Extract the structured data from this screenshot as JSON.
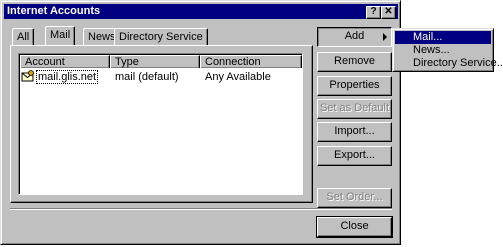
{
  "window": {
    "title": "Internet Accounts",
    "help_glyph": "?",
    "close_glyph": "✕"
  },
  "tabs": [
    {
      "label": "All"
    },
    {
      "label": "Mail"
    },
    {
      "label": "News"
    },
    {
      "label": "Directory Service"
    }
  ],
  "active_tab": "Mail",
  "list": {
    "columns": [
      "Account",
      "Type",
      "Connection"
    ],
    "rows": [
      {
        "account": "mail.glis.net",
        "type": "mail (default)",
        "connection": "Any Available",
        "icon": "mail-account-icon"
      }
    ]
  },
  "buttons": {
    "add": "Add",
    "remove": "Remove",
    "properties": "Properties",
    "set_default": "Set as Default",
    "import": "Import...",
    "export": "Export...",
    "set_order": "Set Order...",
    "close": "Close"
  },
  "add_menu": {
    "items": [
      "Mail...",
      "News...",
      "Directory Service..."
    ],
    "selected": "Mail..."
  },
  "colors": {
    "titlebar": "#000080",
    "face": "#c0c0c0",
    "highlight": "#000080"
  }
}
